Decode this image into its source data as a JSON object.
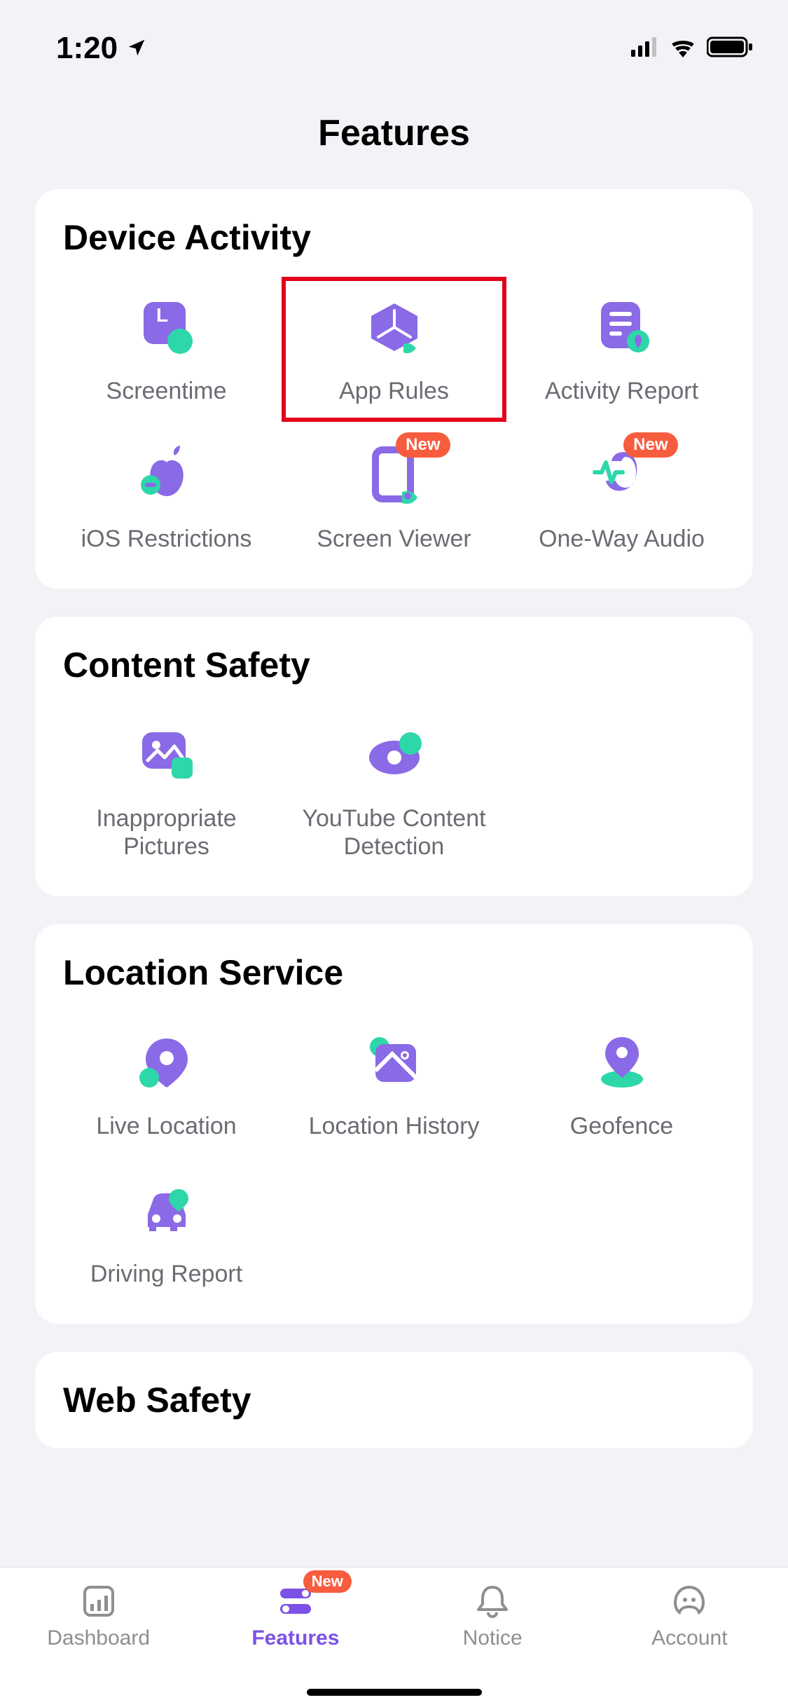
{
  "statusbar": {
    "time": "1:20"
  },
  "header": {
    "title": "Features"
  },
  "sections": {
    "device_activity": {
      "title": "Device Activity",
      "items": [
        {
          "label": "Screentime"
        },
        {
          "label": "App Rules"
        },
        {
          "label": "Activity Report"
        },
        {
          "label": "iOS Restrictions"
        },
        {
          "label": "Screen Viewer",
          "badge": "New"
        },
        {
          "label": "One-Way Audio",
          "badge": "New"
        }
      ]
    },
    "content_safety": {
      "title": "Content Safety",
      "items": [
        {
          "label": "Inappropriate Pictures"
        },
        {
          "label": "YouTube Content Detection"
        }
      ]
    },
    "location_service": {
      "title": "Location Service",
      "items": [
        {
          "label": "Live Location"
        },
        {
          "label": "Location History"
        },
        {
          "label": "Geofence"
        },
        {
          "label": "Driving Report"
        }
      ]
    },
    "web_safety": {
      "title": "Web Safety"
    }
  },
  "tabbar": {
    "items": [
      {
        "label": "Dashboard"
      },
      {
        "label": "Features",
        "badge": "New"
      },
      {
        "label": "Notice"
      },
      {
        "label": "Account"
      }
    ]
  },
  "colors": {
    "accent": "#7b52e5",
    "teal": "#2dd7a9",
    "badge": "#f85c3e"
  }
}
